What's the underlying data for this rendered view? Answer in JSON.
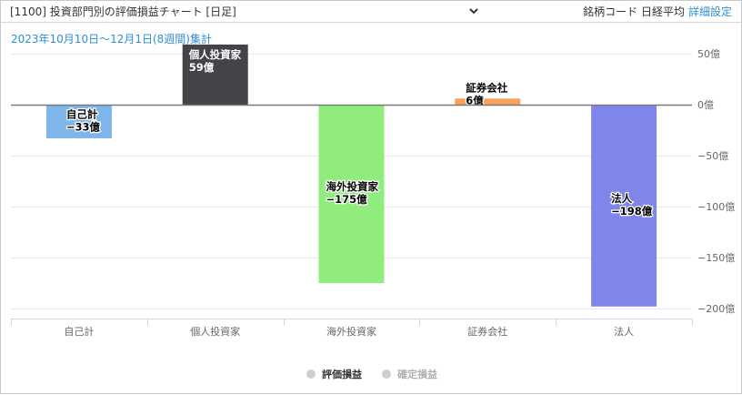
{
  "header": {
    "selector_label": "[1100] 投資部門別の評価損益チャート [日足]",
    "symbol_label": "銘柄コード 日経平均",
    "settings_link": "詳細設定"
  },
  "period_label": "2023年10月10日～12月1日(8週間)集計",
  "legend": {
    "items": [
      {
        "label": "評価損益",
        "active": true
      },
      {
        "label": "確定損益",
        "active": false
      }
    ]
  },
  "colors": {
    "自己計": "#7eb6ec",
    "個人投資家": "#434348",
    "海外投資家": "#90ed7d",
    "証券会社": "#f7a35c",
    "法人": "#8085e9"
  },
  "chart_data": {
    "type": "bar",
    "categories": [
      "自己計",
      "個人投資家",
      "海外投資家",
      "証券会社",
      "法人"
    ],
    "values": [
      -33,
      59,
      -175,
      6,
      -198
    ],
    "data_labels": [
      "−33億",
      "59億",
      "−175億",
      "6億",
      "−198億"
    ],
    "y_ticks": [
      50,
      0,
      -50,
      -100,
      -150,
      -200
    ],
    "y_tick_labels": [
      "50億",
      "0億",
      "−50億",
      "−100億",
      "−150億",
      "−200億"
    ],
    "ylim": [
      -200,
      50
    ],
    "grid": true,
    "legend_position": "bottom"
  }
}
